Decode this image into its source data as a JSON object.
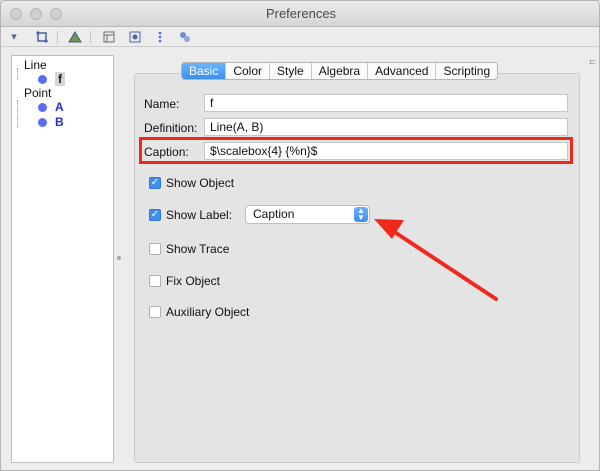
{
  "window": {
    "title": "Preferences"
  },
  "tree": {
    "groups": [
      {
        "label": "Line",
        "items": [
          {
            "label": "f",
            "selected": true
          }
        ]
      },
      {
        "label": "Point",
        "items": [
          {
            "label": "A",
            "selected": false
          },
          {
            "label": "B",
            "selected": false
          }
        ]
      }
    ]
  },
  "tabs": [
    "Basic",
    "Color",
    "Style",
    "Algebra",
    "Advanced",
    "Scripting"
  ],
  "active_tab": "Basic",
  "form": {
    "name_label": "Name:",
    "name_value": "f",
    "definition_label": "Definition:",
    "definition_value": "Line(A, B)",
    "caption_label": "Caption:",
    "caption_value": "$\\scalebox{4} {%n}$"
  },
  "options": {
    "show_object": {
      "label": "Show Object",
      "checked": true
    },
    "show_label": {
      "label": "Show Label:",
      "checked": true
    },
    "label_mode": "Caption",
    "show_trace": {
      "label": "Show Trace",
      "checked": false
    },
    "fix_object": {
      "label": "Fix Object",
      "checked": false
    },
    "auxiliary_object": {
      "label": "Auxiliary Object",
      "checked": false
    }
  },
  "colors": {
    "accent": "#3d8ef0",
    "highlight": "#f1291b"
  },
  "icons": [
    "dropdown-arrow-icon",
    "move-graphics-icon",
    "polygon-icon",
    "layout-icon",
    "view-icon",
    "more-icon",
    "points-icon",
    "check-icon"
  ]
}
